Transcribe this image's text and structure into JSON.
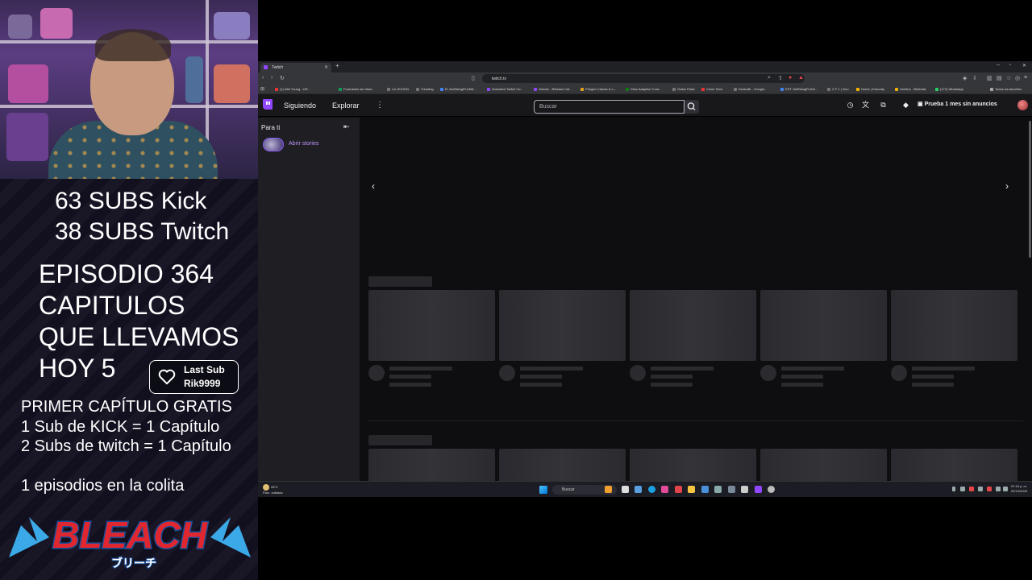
{
  "overlay": {
    "subs_kick": "63 SUBS Kick",
    "subs_twitch": "38 SUBS Twitch",
    "episode_lines": [
      "EPISODIO 364",
      "CAPITULOS",
      "QUE LLEVAMOS",
      "HOY 5"
    ],
    "last_sub_title": "Last Sub",
    "last_sub_name": "Rik9999",
    "rules": [
      "PRIMER CAPÍTULO GRATIS",
      "1 Sub de KICK = 1 Capítulo",
      "2 Subs de twitch = 1 Capítulo"
    ],
    "episodes_queue": "1 episodios en la colita",
    "logo_text": "BLEACH",
    "logo_subtext": "ブリーチ"
  },
  "browser": {
    "tab_title": "Twitch",
    "url": "twitch.tv",
    "bookmarks": [
      "(1) Nhil Young - UR...",
      "Formulario sin título...",
      "LA LEGION",
      "Trending",
      "El JimRisingPLANN...",
      "Animated Twitch Ov...",
      "Games - Release Cal...",
      "Pringrin Classic & c...",
      "Xbox Adaptive Cont...",
      "Guitar Flash",
      "Clone Hero",
      "Donkollir - Google...",
      "EST JimRisingPLAN...",
      "X F 1 | Xico",
      "Home | Donodip",
      "Uneflon - Bimbatic",
      "(172) WhatsApp",
      "Todos los favoritos"
    ],
    "colors": {
      "accent": "#9147ff",
      "stories": "#bf94ff"
    }
  },
  "twitch": {
    "nav_following": "Siguiendo",
    "nav_browse": "Explorar",
    "search_placeholder": "Buscar",
    "turbo_cta": "Prueba 1 mes sin anuncios",
    "sidebar_title": "Para ti",
    "stories_label": "Abrir stories"
  },
  "taskbar": {
    "weather_temp": "28°C",
    "weather_desc": "Parc. nublado",
    "search_label": "Buscar",
    "time": "07:15 p. m.",
    "date": "02/12/2025"
  }
}
